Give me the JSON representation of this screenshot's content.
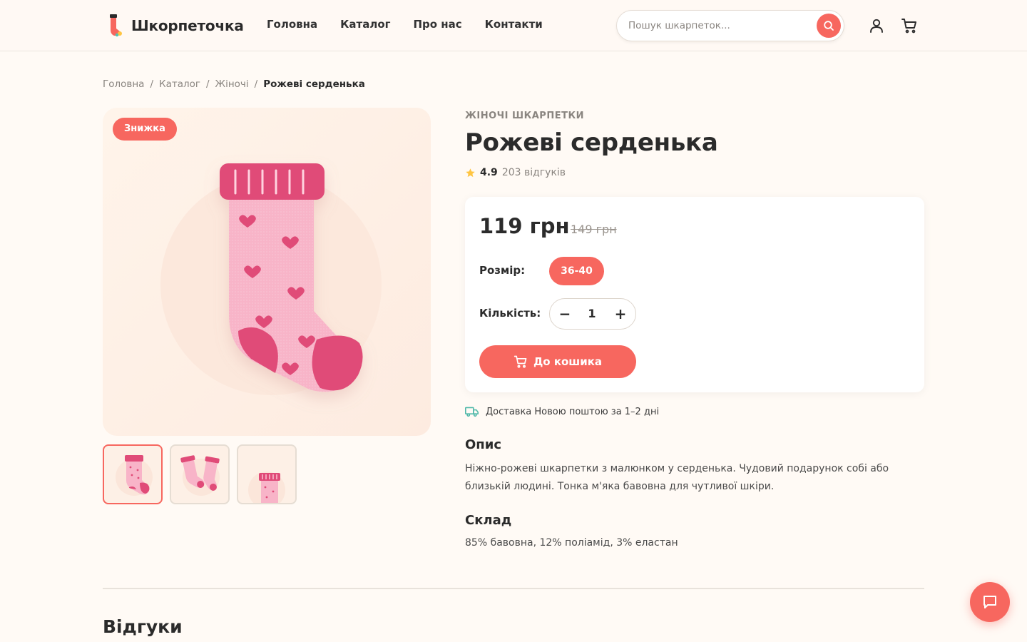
{
  "brand": {
    "name": "Шкорпеточка"
  },
  "nav": [
    {
      "label": "Головна"
    },
    {
      "label": "Каталог"
    },
    {
      "label": "Про нас"
    },
    {
      "label": "Контакти"
    }
  ],
  "search": {
    "placeholder": "Пошук шкарпеток..."
  },
  "breadcrumb": {
    "items": [
      "Головна",
      "Каталог",
      "Жіночі"
    ],
    "current": "Рожеві серденька",
    "separator": "/"
  },
  "product": {
    "badge": "Знижка",
    "category": "ЖІНОЧІ ШКАРПЕТКИ",
    "title": "Рожеві серденька",
    "rating": "4.9",
    "reviews": "203 відгуків",
    "price": "119 грн",
    "old_price": "149 грн",
    "size_label": "Розмір:",
    "size": "36-40",
    "qty_label": "Кількість:",
    "qty": "1",
    "qty_minus": "−",
    "qty_plus": "+",
    "cart_button": "До кошика",
    "delivery": "Доставка Новою поштою за 1–2 дні",
    "description_title": "Опис",
    "description": "Ніжно-рожеві шкарпетки з малюнком у серденька. Чудовий подарунок собі або близькій людині. Тонка м'яка бавовна для чутливої шкіри.",
    "composition_title": "Склад",
    "composition": "85% бавовна, 12% поліамід, 3% еластан"
  },
  "reviews_section": {
    "title": "Відгуки"
  },
  "colors": {
    "accent": "#f7675f",
    "sock_pink": "#f8b4c8",
    "sock_dark": "#e04b78",
    "background": "#fffaf5"
  },
  "icons": [
    "sock-logo-icon",
    "search-icon",
    "user-icon",
    "cart-icon",
    "star-icon",
    "truck-icon",
    "chat-icon"
  ]
}
